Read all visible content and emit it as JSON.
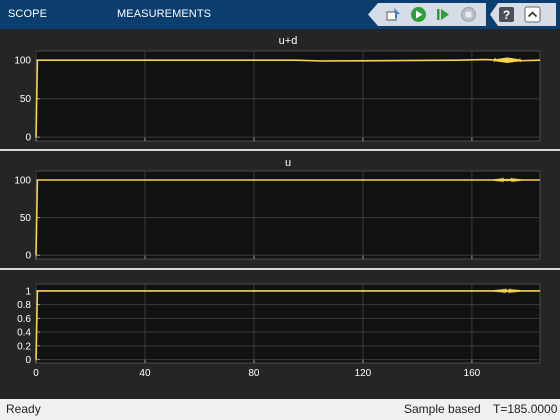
{
  "toolbar": {
    "tabs": [
      {
        "label": "SCOPE",
        "icon": ""
      },
      {
        "label": "MEASUREMENTS",
        "icon": ""
      }
    ],
    "icons": [
      "find-signal-icon",
      "run-icon",
      "step-forward-icon",
      "stop-icon",
      "help-icon",
      "collapse-icon"
    ]
  },
  "status": {
    "ready": "Ready",
    "mode": "Sample based",
    "time": "T=185.0000"
  },
  "colors": {
    "toolbar": "#0b3d6e",
    "plot_bg": "#111111",
    "signal": "#f7d44f",
    "grid": "#3a3a3a",
    "axis_text": "#ffffff"
  },
  "chart_data": [
    {
      "type": "line",
      "title": "u+d",
      "xlim": [
        0,
        185
      ],
      "ylim": [
        -5,
        112
      ],
      "yticks": [
        0,
        50,
        100
      ],
      "xticks": [
        0,
        40,
        80,
        120,
        160
      ],
      "show_xticklabels": false,
      "grid": true,
      "series": [
        {
          "name": "",
          "x": [
            0,
            0.5,
            1,
            95,
            105,
            155,
            165,
            175,
            185
          ],
          "y": [
            0,
            100,
            100,
            100,
            99,
            100,
            101,
            99,
            100
          ]
        }
      ]
    },
    {
      "type": "line",
      "title": "u",
      "xlim": [
        0,
        185
      ],
      "ylim": [
        -5,
        112
      ],
      "yticks": [
        0,
        50,
        100
      ],
      "xticks": [
        0,
        40,
        80,
        120,
        160
      ],
      "show_xticklabels": false,
      "grid": true,
      "series": [
        {
          "name": "",
          "x": [
            0,
            0.5,
            1,
            185
          ],
          "y": [
            0,
            100,
            100,
            100
          ]
        }
      ]
    },
    {
      "type": "line",
      "title": "",
      "xlim": [
        0,
        185
      ],
      "ylim": [
        -0.05,
        1.1
      ],
      "yticks": [
        0,
        0.2,
        0.4,
        0.6,
        0.8,
        1
      ],
      "ytick_labels": [
        "0",
        "0.2",
        "0.4",
        "0.6",
        "0.8",
        "1"
      ],
      "xticks": [
        0,
        40,
        80,
        120,
        160
      ],
      "show_xticklabels": true,
      "grid": true,
      "series": [
        {
          "name": "",
          "x": [
            0,
            0.5,
            1,
            175,
            185
          ],
          "y": [
            0,
            1,
            1,
            1,
            1
          ]
        }
      ]
    }
  ]
}
